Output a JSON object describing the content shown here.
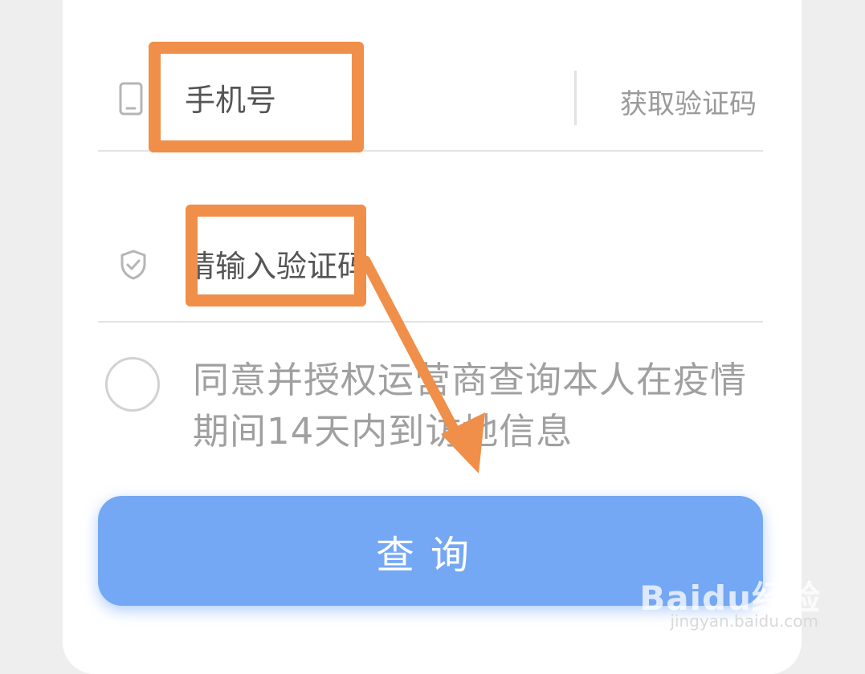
{
  "form": {
    "phone": {
      "icon": "phone-icon",
      "placeholder": "手机号",
      "get_code_label": "获取验证码"
    },
    "code": {
      "icon": "shield-check-icon",
      "placeholder": "请输入验证码"
    },
    "agreement": {
      "text": "同意并授权运营商查询本人在疫情期间14天内到访地信息",
      "checked": false
    },
    "submit_label": "查询"
  },
  "annotation": {
    "color": "#ef8f49"
  },
  "watermark": {
    "logo_text": "Baidu经验",
    "url": "jingyan.baidu.com"
  },
  "colors": {
    "button_bg": "#74a8f5",
    "text_muted": "#a0a0a0",
    "divider": "#e3e3e3"
  }
}
